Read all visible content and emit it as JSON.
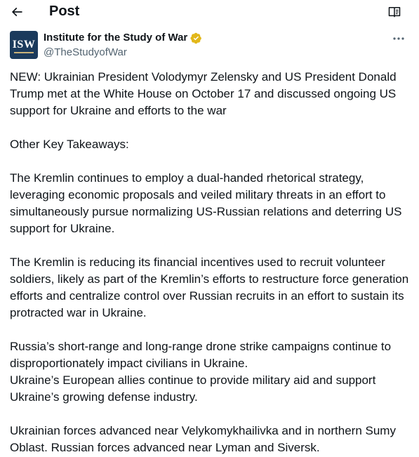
{
  "header": {
    "title": "Post",
    "back_icon": "arrow-left-icon",
    "reader_icon": "reader-mode-icon"
  },
  "author": {
    "display_name": "Institute for the Study of War",
    "handle": "@TheStudyofWar",
    "avatar_text": "ISW",
    "verified": true,
    "verified_color": "#e2b719",
    "more_icon": "more-dots-icon"
  },
  "tweet": {
    "paragraphs": [
      "NEW: Ukrainian President Volodymyr Zelensky and US President Donald Trump met at the White House on October 17 and discussed ongoing US support for Ukraine and efforts to the war",
      "Other Key Takeaways:",
      "The Kremlin continues to employ a dual-handed rhetorical strategy, leveraging economic proposals and veiled military threats in an effort to simultaneously pursue normalizing US-Russian relations and deterring US support for Ukraine.",
      "The Kremlin is reducing its financial incentives used to recruit volunteer soldiers, likely as part of the Kremlin’s efforts to restructure force generation efforts and centralize control over Russian recruits in an effort to sustain its protracted war in Ukraine.",
      "Russia’s short-range and long-range drone strike campaigns continue to disproportionately impact civilians in Ukraine.",
      "Ukraine’s European allies continue to provide military aid and support Ukraine’s growing defense industry.",
      "Ukrainian forces advanced near Velykomykhailivka and in northern Sumy Oblast. Russian forces advanced near Lyman and Siversk."
    ]
  },
  "colors": {
    "text_primary": "#0f1419",
    "text_secondary": "#536471",
    "avatar_bg": "#1b3a5c"
  }
}
